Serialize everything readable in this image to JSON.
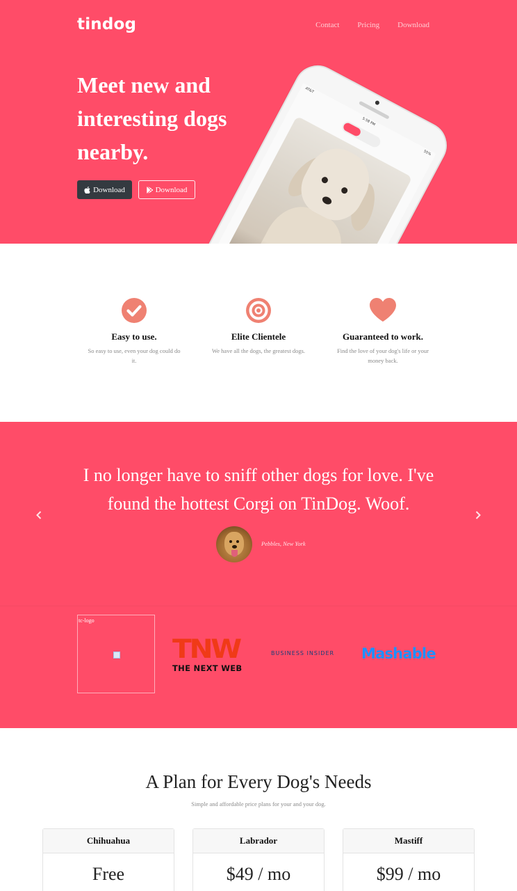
{
  "colors": {
    "brand": "#ff4c68",
    "dark_button": "#343a40",
    "feature_icon": "#ef8172"
  },
  "header": {
    "brand": "tindog",
    "nav": [
      {
        "label": "Contact"
      },
      {
        "label": "Pricing"
      },
      {
        "label": "Download"
      }
    ]
  },
  "hero": {
    "title": "Meet new and interesting dogs nearby.",
    "buttons": [
      {
        "label": "Download",
        "icon": "apple-icon"
      },
      {
        "label": "Download",
        "icon": "google-play-icon"
      }
    ]
  },
  "features": [
    {
      "icon": "check-circle-icon",
      "title": "Easy to use.",
      "text": "So easy to use, even your dog could do it."
    },
    {
      "icon": "bullseye-icon",
      "title": "Elite Clientele",
      "text": "We have all the dogs, the greatest dogs."
    },
    {
      "icon": "heart-icon",
      "title": "Guaranteed to work.",
      "text": "Find the love of your dog's life or your money back."
    }
  ],
  "testimonial": {
    "quote": "I no longer have to sniff other dogs for love. I've found the hottest Corgi on TinDog. Woof.",
    "attribution": "Pebbles, New York"
  },
  "press": {
    "tc_alt": "tc-logo",
    "tnw_mark": "TNW",
    "tnw_text": "THE NEXT WEB",
    "business_insider": "BUSINESS INSIDER",
    "mashable": "Mashable"
  },
  "pricing": {
    "title": "A Plan for Every Dog's Needs",
    "subtitle": "Simple and affordable price plans for your and your dog.",
    "plans": [
      {
        "name": "Chihuahua",
        "price": "Free"
      },
      {
        "name": "Labrador",
        "price": "$49 / mo"
      },
      {
        "name": "Mastiff",
        "price": "$99 / mo"
      }
    ]
  }
}
